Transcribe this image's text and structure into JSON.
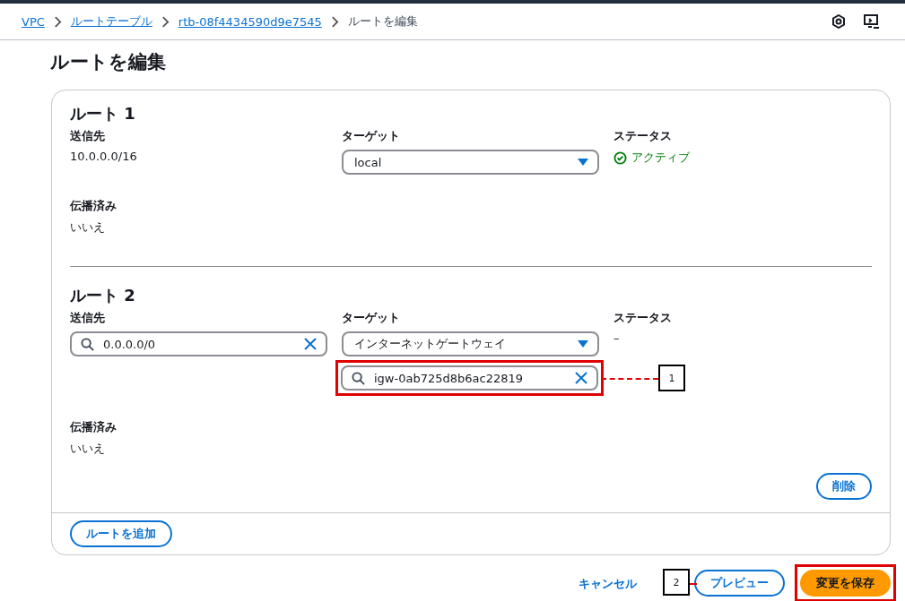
{
  "breadcrumbs": [
    {
      "label": "VPC",
      "kind": "link"
    },
    {
      "label": "ルートテーブル",
      "kind": "link"
    },
    {
      "label": "rtb-08f4434590d9e7545",
      "kind": "link"
    },
    {
      "label": "ルートを編集",
      "kind": "current"
    }
  ],
  "title": "ルートを編集",
  "routes": [
    {
      "heading": "ルート 1",
      "destination": {
        "label": "送信先",
        "kind": "text",
        "value": "10.0.0.0/16"
      },
      "target": {
        "label": "ターゲット",
        "value": "local"
      },
      "status": {
        "label": "ステータス",
        "kind": "active",
        "value": "アクティブ"
      },
      "propagated": {
        "label": "伝播済み",
        "value": "いいえ"
      }
    },
    {
      "heading": "ルート 2",
      "destination": {
        "label": "送信先",
        "kind": "search",
        "value": "0.0.0.0/0"
      },
      "target": {
        "label": "ターゲット",
        "value": "インターネットゲートウェイ",
        "search": {
          "value": "igw-0ab725d8b6ac22819",
          "highlighted": true,
          "callout": "1"
        }
      },
      "status": {
        "label": "ステータス",
        "kind": "none",
        "value": "–"
      },
      "propagated": {
        "label": "伝播済み",
        "value": "いいえ"
      },
      "delete_button": "削除"
    }
  ],
  "add_button": "ルートを追加",
  "footer_buttons": [
    {
      "label": "キャンセル",
      "kind": "link",
      "highlighted": false
    },
    {
      "label": "プレビュー",
      "kind": "secondary",
      "highlighted": false
    },
    {
      "label": "変更を保存",
      "kind": "primary",
      "highlighted": true,
      "callout": "2"
    }
  ]
}
